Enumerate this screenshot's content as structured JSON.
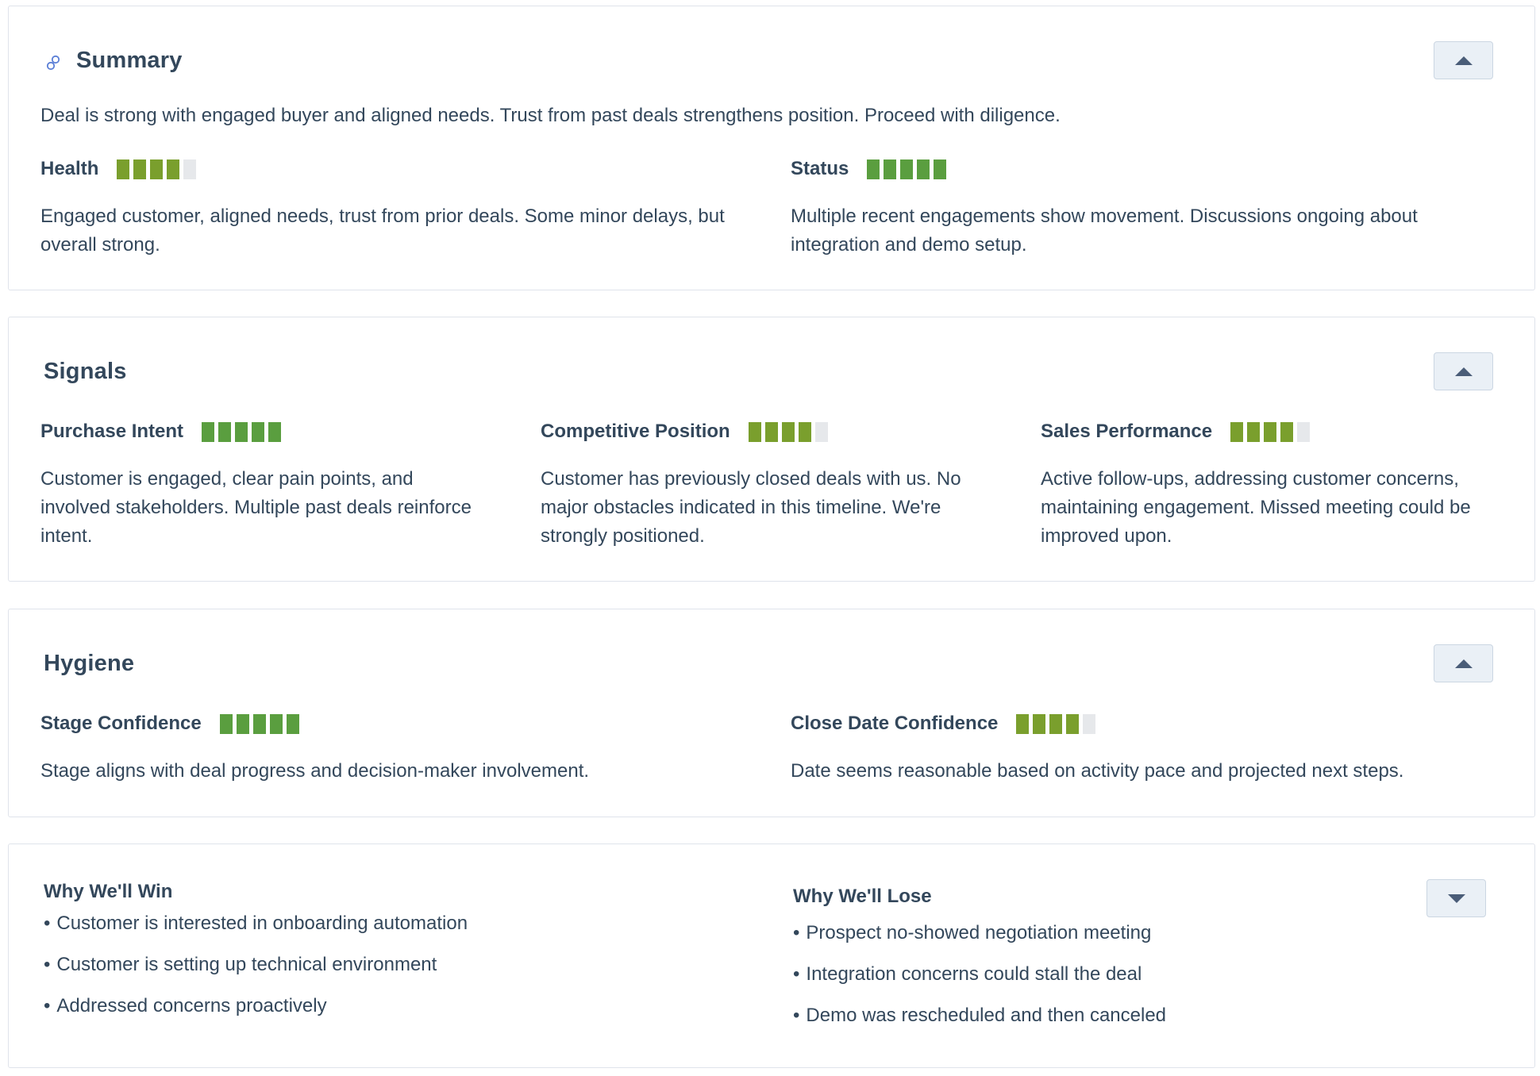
{
  "colors": {
    "bar_full": "#5a9e3f",
    "bar_olive": "#7a9f2d",
    "bar_empty": "#e6e8eb"
  },
  "summary": {
    "title": "Summary",
    "icon": "link-icon",
    "toggle_icon": "chevron-up-icon",
    "text": "Deal is strong with engaged buyer and aligned needs. Trust from past deals strengthens position. Proceed with diligence.",
    "metrics": [
      {
        "label": "Health",
        "score": 4,
        "max": 5,
        "tone": "olive",
        "desc": "Engaged customer, aligned needs, trust from prior deals. Some minor delays, but overall strong."
      },
      {
        "label": "Status",
        "score": 5,
        "max": 5,
        "tone": "full",
        "desc": "Multiple recent engagements show movement. Discussions ongoing about integration and demo setup."
      }
    ]
  },
  "signals": {
    "title": "Signals",
    "toggle_icon": "chevron-up-icon",
    "metrics": [
      {
        "label": "Purchase Intent",
        "score": 5,
        "max": 5,
        "tone": "full",
        "desc": "Customer is engaged, clear pain points, and involved stakeholders. Multiple past deals reinforce intent."
      },
      {
        "label": "Competitive Position",
        "score": 4,
        "max": 5,
        "tone": "olive",
        "desc": "Customer has previously closed deals with us. No major obstacles indicated in this timeline. We're strongly positioned."
      },
      {
        "label": "Sales Performance",
        "score": 4,
        "max": 5,
        "tone": "olive",
        "desc": "Active follow-ups, addressing customer concerns, maintaining engagement. Missed meeting could be improved upon."
      }
    ]
  },
  "hygiene": {
    "title": "Hygiene",
    "toggle_icon": "chevron-up-icon",
    "metrics": [
      {
        "label": "Stage Confidence",
        "score": 5,
        "max": 5,
        "tone": "full",
        "desc": "Stage aligns with deal progress and decision-maker involvement."
      },
      {
        "label": "Close Date Confidence",
        "score": 4,
        "max": 5,
        "tone": "olive",
        "desc": "Date seems reasonable based on activity pace and projected next steps."
      }
    ]
  },
  "win_lose": {
    "toggle_icon": "chevron-down-icon",
    "win_title": "Why We'll Win",
    "win_items": [
      "Customer is interested in onboarding automation",
      "Customer is setting up technical environment",
      "Addressed concerns proactively"
    ],
    "lose_title": "Why We'll Lose",
    "lose_items": [
      "Prospect no-showed negotiation meeting",
      "Integration concerns could stall the deal",
      "Demo was rescheduled and then canceled"
    ]
  }
}
